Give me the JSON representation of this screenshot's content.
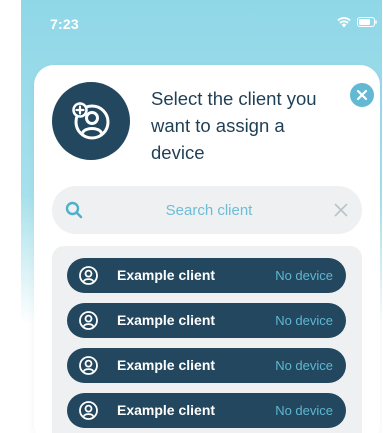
{
  "status_bar": {
    "time": "7:23",
    "wifi_icon": "wifi-icon",
    "battery_icon": "battery-icon"
  },
  "dialog": {
    "title": "Select the client you want to assign a device",
    "avatar_icon": "add-user-icon",
    "close_icon": "close-icon"
  },
  "search": {
    "placeholder": "Search client",
    "value": "",
    "search_icon": "search-icon",
    "clear_icon": "clear-icon"
  },
  "clients": [
    {
      "name": "Example client",
      "status": "No device"
    },
    {
      "name": "Example client",
      "status": "No device"
    },
    {
      "name": "Example client",
      "status": "No device"
    },
    {
      "name": "Example client",
      "status": "No device"
    }
  ],
  "colors": {
    "primary_dark": "#23475e",
    "accent": "#5fb7d1",
    "panel": "#eef0f2",
    "background_top": "#8fd7e7"
  }
}
